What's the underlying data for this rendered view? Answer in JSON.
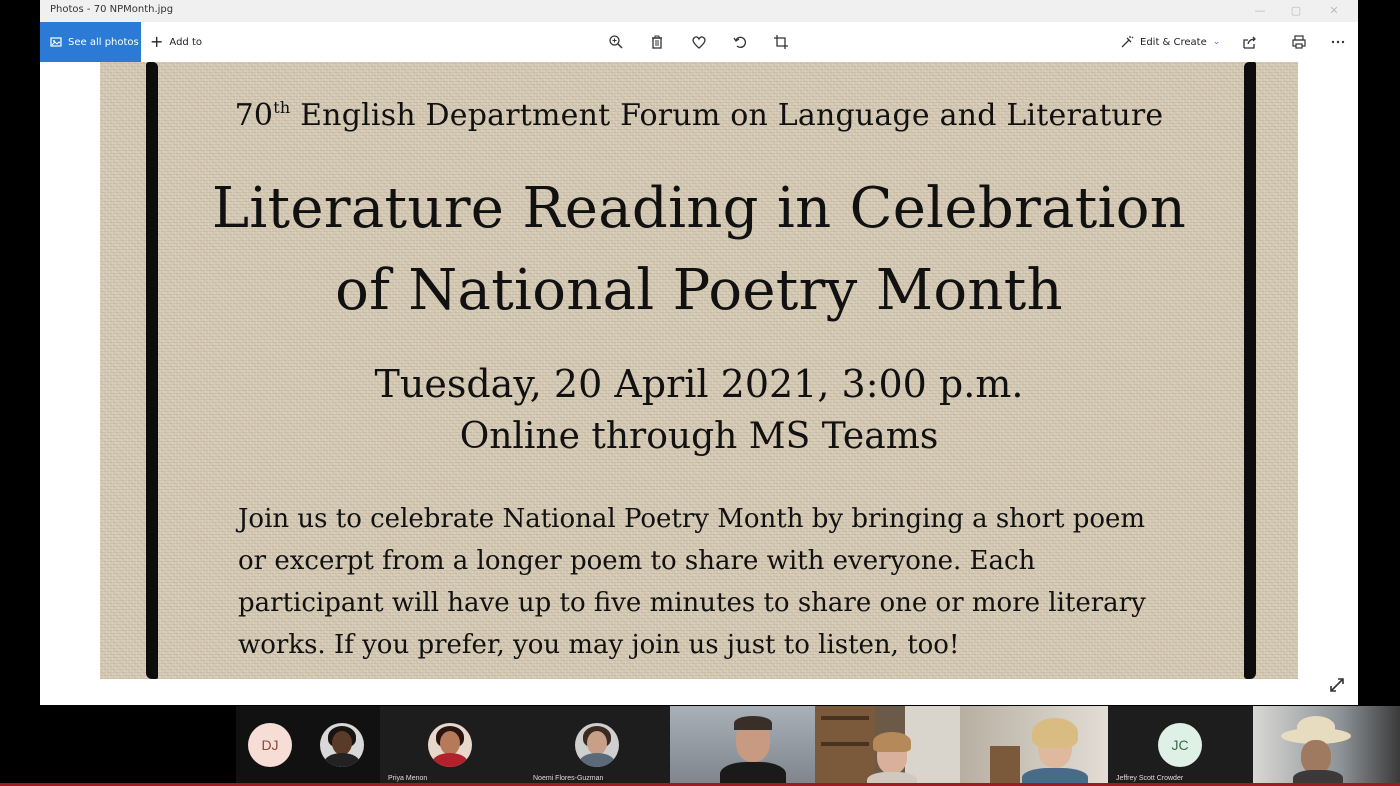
{
  "window": {
    "title": "Photos - 70 NPMonth.jpg",
    "controls": {
      "minimize": "—",
      "maximize": "▢",
      "close": "✕"
    }
  },
  "toolbar": {
    "see_all_label": "See all photos",
    "add_to_label": "Add to",
    "edit_create_label": "Edit & Create",
    "icons": [
      "zoom-icon",
      "delete-icon",
      "favorite-icon",
      "rotate-icon",
      "crop-icon",
      "share-icon",
      "print-icon",
      "more-icon"
    ]
  },
  "poster": {
    "forum_number": "70",
    "forum_suffix": "th",
    "forum_rest": " English Department Forum on Language and Literature",
    "title_line1": "Literature Reading in Celebration",
    "title_line2": "of National Poetry Month",
    "date_line": "Tuesday, 20 April 2021, 3:00 p.m.",
    "online_line": "Online through MS Teams",
    "body": "Join us to celebrate National Poetry Month by bringing a short poem or excerpt from a longer poem to share with everyone. Each participant will have up to five minutes to share one or more literary works.  If you prefer, you may join us just to listen, too!"
  },
  "participants": [
    {
      "initials": "DJ",
      "name": ""
    },
    {
      "initials": "",
      "name": ""
    },
    {
      "initials": "",
      "name": "Priya Menon"
    },
    {
      "initials": "",
      "name": "Noemi Flores-Guzman"
    },
    {
      "initials": "",
      "name": ""
    },
    {
      "initials": "",
      "name": ""
    },
    {
      "initials": "",
      "name": ""
    },
    {
      "initials": "JC",
      "name": "Jeffrey Scott Crowder"
    },
    {
      "initials": "",
      "name": ""
    }
  ],
  "colors": {
    "accent": "#2b7bd6",
    "poster_background": "#d6cbb6",
    "poster_border": "#0d0d0d"
  }
}
